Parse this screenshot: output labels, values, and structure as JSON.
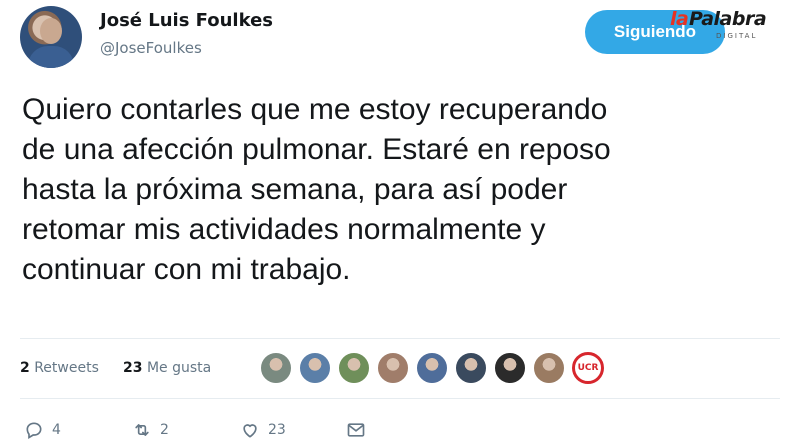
{
  "author": {
    "name": "José Luis Foulkes",
    "handle": "@JoseFoulkes"
  },
  "follow_button": {
    "label": "Siguiendo"
  },
  "watermark": {
    "la": "la",
    "palabra": "Palabra",
    "digital": "DIGITAL"
  },
  "tweet": {
    "lines": [
      "Quiero contarles que me estoy recuperando",
      "de una afección pulmonar. Estaré en reposo",
      "hasta la próxima semana, para así poder",
      "retomar mis actividades normalmente y",
      "continuar con mi trabajo."
    ]
  },
  "stats": {
    "retweets_count": "2",
    "retweets_label": "Retweets",
    "likes_count": "23",
    "likes_label": "Me gusta"
  },
  "likers": [
    {
      "color": "#7a8a80"
    },
    {
      "color": "#5b7fa8"
    },
    {
      "color": "#6f8f5a"
    },
    {
      "color": "#a07d6a"
    },
    {
      "color": "#4f6d9a"
    },
    {
      "color": "#3a4a5e"
    },
    {
      "color": "#2b2b2b"
    },
    {
      "color": "#9a7b62"
    },
    {
      "color": "#d7262d",
      "label": "UCR"
    }
  ],
  "actions": {
    "reply_count": "4",
    "retweet_count": "2",
    "like_count": "23"
  },
  "colors": {
    "accent": "#1da1f2",
    "text": "#14171a",
    "muted": "#657786"
  }
}
